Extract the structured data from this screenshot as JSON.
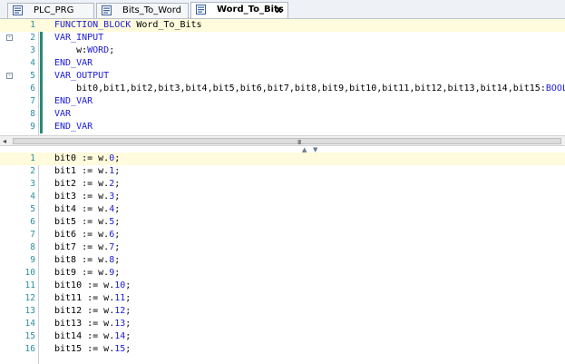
{
  "tabs": [
    {
      "label": "PLC_PRG",
      "active": false
    },
    {
      "label": "Bits_To_Word",
      "active": false
    },
    {
      "label": "Word_To_Bits",
      "active": true,
      "close_label": "x"
    }
  ],
  "declaration_editor": {
    "lines": [
      {
        "n": "1",
        "tokens": [
          {
            "t": "FUNCTION_BLOCK",
            "k": true
          },
          {
            "t": " Word_To_Bits"
          }
        ]
      },
      {
        "n": "2",
        "fold": "-",
        "tokens": [
          {
            "t": "VAR_INPUT",
            "k": true
          }
        ]
      },
      {
        "n": "3",
        "tokens": [
          {
            "t": "    w:"
          },
          {
            "t": "WORD",
            "k": true
          },
          {
            "t": ";"
          }
        ]
      },
      {
        "n": "4",
        "tokens": [
          {
            "t": "END_VAR",
            "k": true
          }
        ]
      },
      {
        "n": "5",
        "fold": "-",
        "tokens": [
          {
            "t": "VAR_OUTPUT",
            "k": true
          }
        ]
      },
      {
        "n": "6",
        "tokens": [
          {
            "t": "    bit0,bit1,bit2,bit3,bit4,bit5,bit6,bit7,bit8,bit9,bit10,bit11,bit12,bit13,bit14,bit15:"
          },
          {
            "t": "BOOL",
            "k": true
          },
          {
            "t": ";"
          }
        ]
      },
      {
        "n": "7",
        "tokens": [
          {
            "t": "END_VAR",
            "k": true
          }
        ]
      },
      {
        "n": "8",
        "tokens": [
          {
            "t": "VAR",
            "k": true
          }
        ]
      },
      {
        "n": "9",
        "tokens": [
          {
            "t": "END_VAR",
            "k": true
          }
        ]
      }
    ]
  },
  "scrollbar": {
    "left_arrow": "◂",
    "grip": "III"
  },
  "splitter": {
    "up": "▲",
    "down": "▼"
  },
  "implementation_editor": {
    "lines": [
      {
        "n": "1",
        "v": "bit0 := w.",
        "b": "0"
      },
      {
        "n": "2",
        "v": "bit1 := w.",
        "b": "1"
      },
      {
        "n": "3",
        "v": "bit2 := w.",
        "b": "2"
      },
      {
        "n": "4",
        "v": "bit3 := w.",
        "b": "3"
      },
      {
        "n": "5",
        "v": "bit4 := w.",
        "b": "4"
      },
      {
        "n": "6",
        "v": "bit5 := w.",
        "b": "5"
      },
      {
        "n": "7",
        "v": "bit6 := w.",
        "b": "6"
      },
      {
        "n": "8",
        "v": "bit7 := w.",
        "b": "7"
      },
      {
        "n": "9",
        "v": "bit8 := w.",
        "b": "8"
      },
      {
        "n": "10",
        "v": "bit9 := w.",
        "b": "9"
      },
      {
        "n": "11",
        "v": "bit10 := w.",
        "b": "10"
      },
      {
        "n": "12",
        "v": "bit11 := w.",
        "b": "11"
      },
      {
        "n": "13",
        "v": "bit12 := w.",
        "b": "12"
      },
      {
        "n": "14",
        "v": "bit13 := w.",
        "b": "13"
      },
      {
        "n": "15",
        "v": "bit14 := w.",
        "b": "14"
      },
      {
        "n": "16",
        "v": "bit15 := w.",
        "b": "15"
      }
    ]
  },
  "colors": {
    "keyword": "#1b1bd6",
    "line_number": "#2b8f9e",
    "current_line": "#fffbdc",
    "change_bar": "#2a8a73"
  }
}
